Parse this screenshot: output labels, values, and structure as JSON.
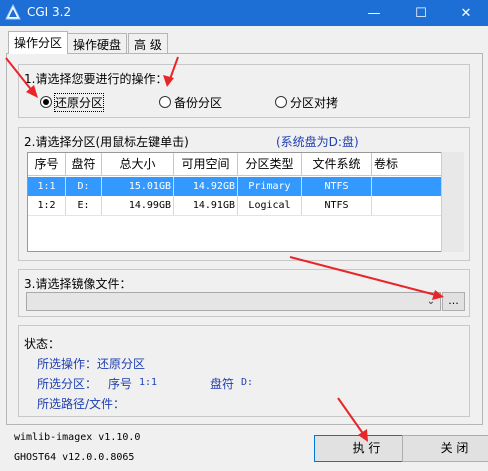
{
  "window": {
    "title": "CGI 3.2",
    "controls": {
      "minimize": "—",
      "maximize": "☐",
      "close": "✕"
    },
    "accent": "#1d6fd6"
  },
  "tabs": [
    "操作分区",
    "操作硬盘",
    "高 级"
  ],
  "operation": {
    "label": "1.请选择您要进行的操作：",
    "options": [
      "还原分区",
      "备份分区",
      "分区对拷"
    ],
    "selected": 0
  },
  "partition": {
    "label": "2.请选择分区(用鼠标左键单击)",
    "system_disk": "(系统盘为D:盘)",
    "columns": [
      "序号",
      "盘符",
      "总大小",
      "可用空间",
      "分区类型",
      "文件系统",
      "卷标"
    ],
    "rows": [
      [
        "1:1",
        "D:",
        "15.01GB",
        "14.92GB",
        "Primary",
        "NTFS",
        ""
      ],
      [
        "1:2",
        "E:",
        "14.99GB",
        "14.91GB",
        "Logical",
        "NTFS",
        ""
      ]
    ],
    "selected_row": 0,
    "selection_color": "#3399ff"
  },
  "image": {
    "label": "3.请选择镜像文件：",
    "value": "",
    "browse_label": "..."
  },
  "status": {
    "label": "状态：",
    "operation_line": "所选操作：还原分区",
    "partition_prefix": "所选分区：",
    "partition_seq_label": "序号",
    "partition_seq": "1:1",
    "drive_label": "盘符",
    "drive": "D:",
    "path_line": "所选路径/文件：",
    "text_color": "#1e3fb0"
  },
  "versions": {
    "wimlib": "wimlib-imagex v1.10.0",
    "ghost": "GHOST64 v12.0.0.8065"
  },
  "buttons": {
    "execute": "执 行",
    "close": "关 闭"
  },
  "annotation_color": "#e8262a"
}
